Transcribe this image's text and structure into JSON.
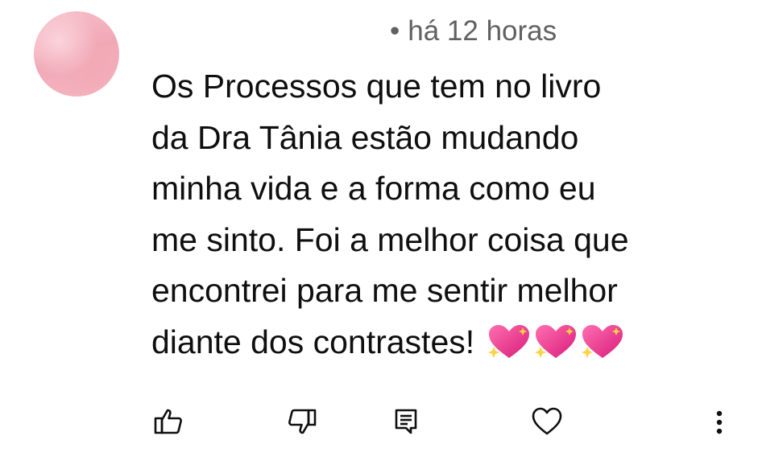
{
  "comment": {
    "timestamp": "há 12 horas",
    "text": "Os Processos que tem no livro\nda Dra Tânia estão mudando\nminha vida e a forma como eu\nme sinto. Foi a melhor coisa que\nencontrei para me sentir melhor\ndiante dos contrastes! ",
    "emoji": [
      "sparkling-heart",
      "sparkling-heart",
      "sparkling-heart"
    ]
  },
  "actions": [
    {
      "icon": "thumbs-up-icon"
    },
    {
      "icon": "thumbs-down-icon"
    },
    {
      "icon": "reply-icon"
    },
    {
      "icon": "heart-icon"
    },
    {
      "icon": "more-vertical-icon"
    }
  ],
  "colors": {
    "text": "#0f0f0f",
    "meta": "#606060",
    "icon": "#0f0f0f",
    "heart": "#e8307a",
    "avatar": "#f2a9b6"
  }
}
